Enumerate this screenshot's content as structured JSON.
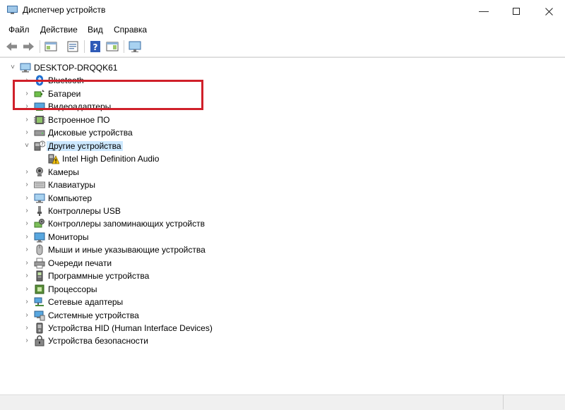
{
  "window": {
    "title": "Диспетчер устройств"
  },
  "menu": [
    "Файл",
    "Действие",
    "Вид",
    "Справка"
  ],
  "toolbar": {
    "buttons": [
      "back-arrow-icon",
      "forward-arrow-icon",
      "show-hide-console-tree-icon",
      "properties-icon",
      "help-icon",
      "action-pane-icon",
      "monitor-scan-icon"
    ]
  },
  "tree": {
    "root": {
      "label": "DESKTOP-DRQQK61",
      "icon": "computer-icon"
    },
    "items": [
      {
        "label": "Bluetooth",
        "icon": "bluetooth-icon",
        "expanded": false
      },
      {
        "label": "Батареи",
        "icon": "battery-icon",
        "expanded": false
      },
      {
        "label": "Видеоадаптеры",
        "icon": "display-adapter-icon",
        "expanded": false
      },
      {
        "label": "Встроенное ПО",
        "icon": "firmware-icon",
        "expanded": false
      },
      {
        "label": "Дисковые устройства",
        "icon": "disk-drive-icon",
        "expanded": false
      },
      {
        "label": "Другие устройства",
        "icon": "unknown-device-icon",
        "expanded": true,
        "selected": true,
        "children": [
          {
            "label": "Intel High Definition Audio",
            "icon": "warning-device-icon"
          }
        ]
      },
      {
        "label": "Камеры",
        "icon": "camera-icon",
        "expanded": false
      },
      {
        "label": "Клавиатуры",
        "icon": "keyboard-icon",
        "expanded": false
      },
      {
        "label": "Компьютер",
        "icon": "computer-icon",
        "expanded": false
      },
      {
        "label": "Контроллеры USB",
        "icon": "usb-icon",
        "expanded": false
      },
      {
        "label": "Контроллеры запоминающих устройств",
        "icon": "storage-controller-icon",
        "expanded": false
      },
      {
        "label": "Мониторы",
        "icon": "monitor-icon",
        "expanded": false
      },
      {
        "label": "Мыши и иные указывающие устройства",
        "icon": "mouse-icon",
        "expanded": false
      },
      {
        "label": "Очереди печати",
        "icon": "printer-icon",
        "expanded": false
      },
      {
        "label": "Программные устройства",
        "icon": "software-device-icon",
        "expanded": false
      },
      {
        "label": "Процессоры",
        "icon": "processor-icon",
        "expanded": false
      },
      {
        "label": "Сетевые адаптеры",
        "icon": "network-adapter-icon",
        "expanded": false
      },
      {
        "label": "Системные устройства",
        "icon": "system-device-icon",
        "expanded": false
      },
      {
        "label": "Устройства HID (Human Interface Devices)",
        "icon": "hid-icon",
        "expanded": false
      },
      {
        "label": "Устройства безопасности",
        "icon": "security-device-icon",
        "expanded": false
      }
    ]
  },
  "colors": {
    "selection": "#cce8ff",
    "highlight_frame": "#d0202a"
  }
}
